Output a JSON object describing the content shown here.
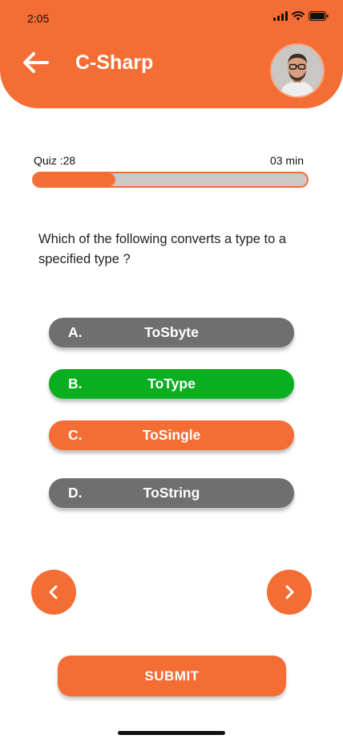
{
  "status_bar": {
    "time": "2:05",
    "icons": [
      "signal-icon",
      "wifi-icon",
      "battery-icon"
    ]
  },
  "header": {
    "title": "C-Sharp",
    "back_icon": "arrow-left-icon",
    "avatar": "user-avatar"
  },
  "quiz": {
    "label": "Quiz :28",
    "time": "03 min",
    "progress_fraction": 0.3
  },
  "question": {
    "text": "Which of the following converts a type to a specified type ?"
  },
  "options": [
    {
      "letter": "A.",
      "text": "ToSbyte",
      "state": "default"
    },
    {
      "letter": "B.",
      "text": "ToType",
      "state": "correct"
    },
    {
      "letter": "C.",
      "text": "ToSingle",
      "state": "selected"
    },
    {
      "letter": "D.",
      "text": "ToString",
      "state": "default"
    }
  ],
  "navigation": {
    "prev_icon": "chevron-left-icon",
    "next_icon": "chevron-right-icon"
  },
  "submit_label": "SUBMIT",
  "colors": {
    "accent": "#f46d35",
    "correct": "#0aaf1f",
    "neutral": "#6f6f6f",
    "track": "#cdc8c8"
  }
}
